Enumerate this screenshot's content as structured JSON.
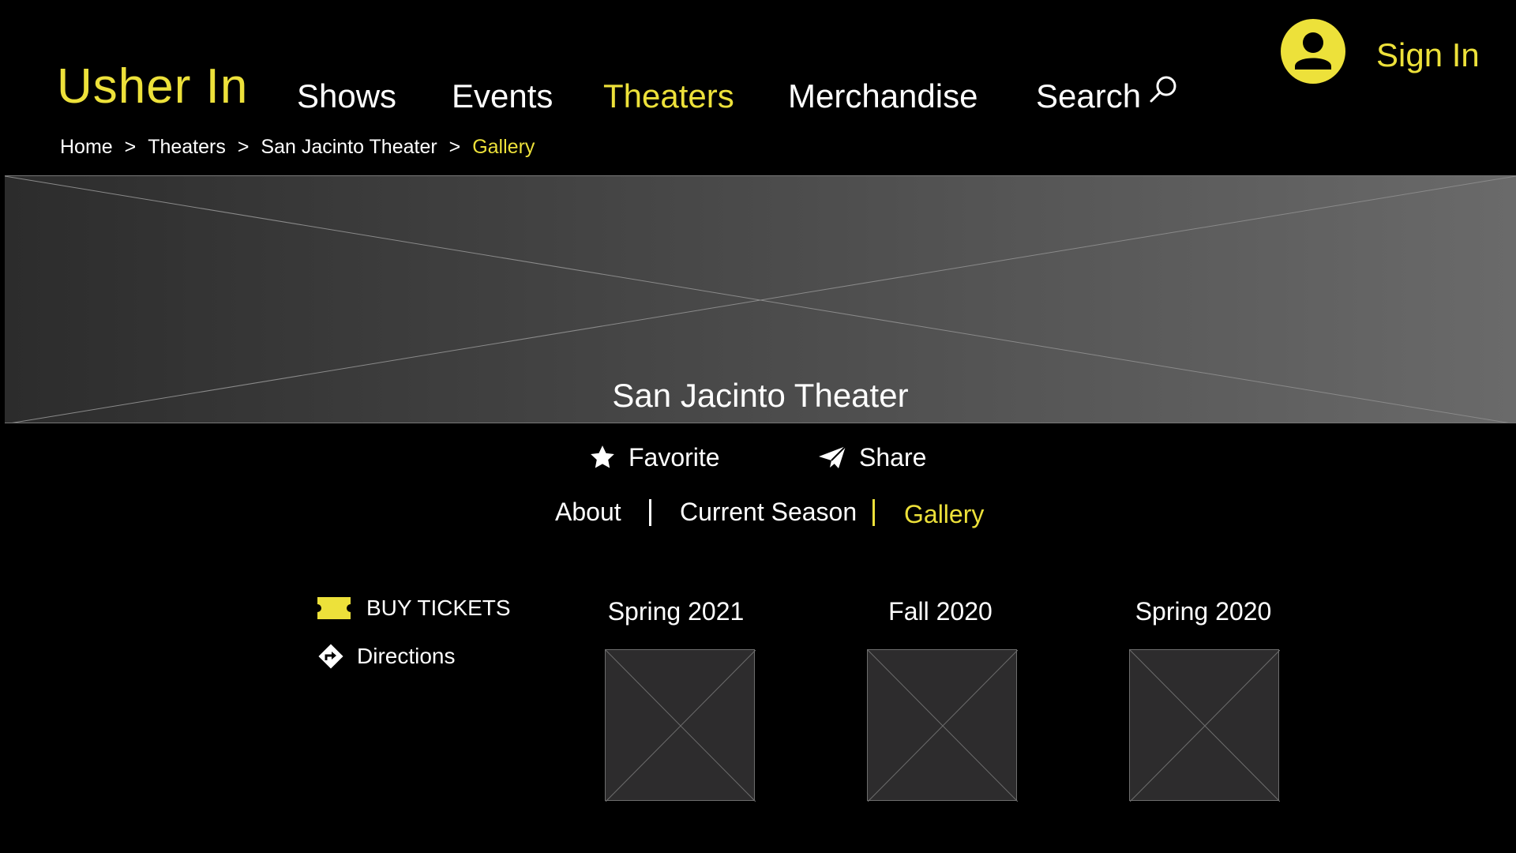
{
  "header": {
    "logo": "Usher In",
    "nav": [
      "Shows",
      "Events",
      "Theaters",
      "Merchandise",
      "Search"
    ],
    "active_nav": "Theaters",
    "signin": "Sign In"
  },
  "breadcrumb": [
    "Home",
    "Theaters",
    "San Jacinto Theater",
    "Gallery"
  ],
  "breadcrumb_sep": ">",
  "hero": {
    "title": "San Jacinto Theater"
  },
  "actions": {
    "favorite": "Favorite",
    "share": "Share"
  },
  "tabs": [
    "About",
    "Current Season",
    "Gallery"
  ],
  "active_tab": "Gallery",
  "side_links": {
    "buy_tickets": "BUY TICKETS",
    "directions": "Directions"
  },
  "gallery": [
    {
      "label": "Spring 2021"
    },
    {
      "label": "Fall 2020"
    },
    {
      "label": "Spring 2020"
    }
  ],
  "colors": {
    "accent": "#ede13a",
    "background": "#000000",
    "placeholder": "#2d2c2d"
  },
  "icons": [
    "user-icon",
    "search-icon",
    "star-icon",
    "send-icon",
    "ticket-icon",
    "directions-icon"
  ]
}
